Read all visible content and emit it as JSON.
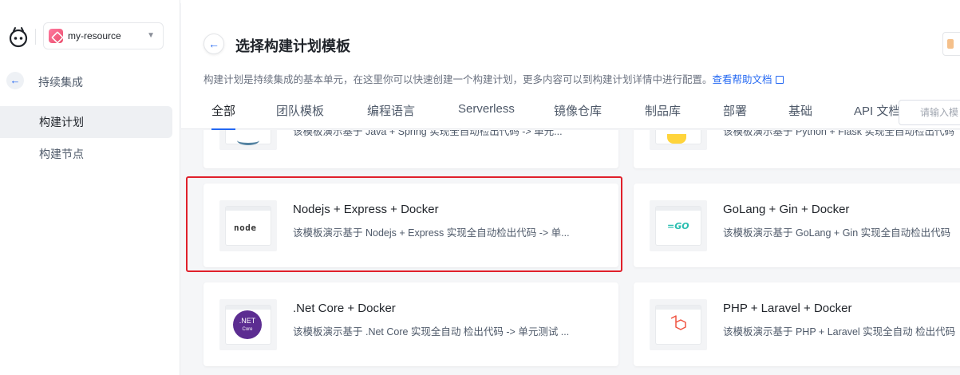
{
  "sidebar": {
    "project_name": "my-resource",
    "section_title": "持续集成",
    "items": [
      {
        "label": "构建计划",
        "active": true
      },
      {
        "label": "构建节点",
        "active": false
      }
    ]
  },
  "header": {
    "title": "选择构建计划模板",
    "description": "构建计划是持续集成的基本单元，在这里你可以快速创建一个构建计划，更多内容可以到构建计划详情中进行配置。",
    "help_link": "查看帮助文档",
    "search_placeholder": "请输入模"
  },
  "tabs": [
    {
      "label": "全部",
      "active": true
    },
    {
      "label": "团队模板"
    },
    {
      "label": "编程语言"
    },
    {
      "label": "Serverless"
    },
    {
      "label": "镜像仓库"
    },
    {
      "label": "制品库"
    },
    {
      "label": "部署"
    },
    {
      "label": "基础"
    },
    {
      "label": "API 文档"
    }
  ],
  "cards": [
    {
      "title": "",
      "desc": "该模板演示基于 Java + Spring 实现全自动检出代码 -> 单元...",
      "icon": "java-icon"
    },
    {
      "title": "",
      "desc": "该模板演示基于 Python + Flask 实现全自动检出代码",
      "icon": "python-icon"
    },
    {
      "title": "Nodejs + Express + Docker",
      "desc": "该模板演示基于 Nodejs + Express 实现全自动检出代码 -> 单...",
      "icon": "nodejs-icon",
      "logo_text": "node"
    },
    {
      "title": "GoLang + Gin + Docker",
      "desc": "该模板演示基于 GoLang + Gin 实现全自动检出代码",
      "icon": "golang-icon",
      "logo_text": "=GO"
    },
    {
      "title": ".Net Core + Docker",
      "desc": "该模板演示基于 .Net Core 实现全自动 检出代码 -> 单元测试 ...",
      "icon": "dotnet-icon",
      "logo_text": ".NET",
      "logo_sub": "Core"
    },
    {
      "title": "PHP + Laravel + Docker",
      "desc": "该模板演示基于 PHP + Laravel 实现全自动 检出代码",
      "icon": "laravel-icon"
    }
  ],
  "colors": {
    "accent": "#2468f2",
    "highlight": "#e0202b"
  }
}
